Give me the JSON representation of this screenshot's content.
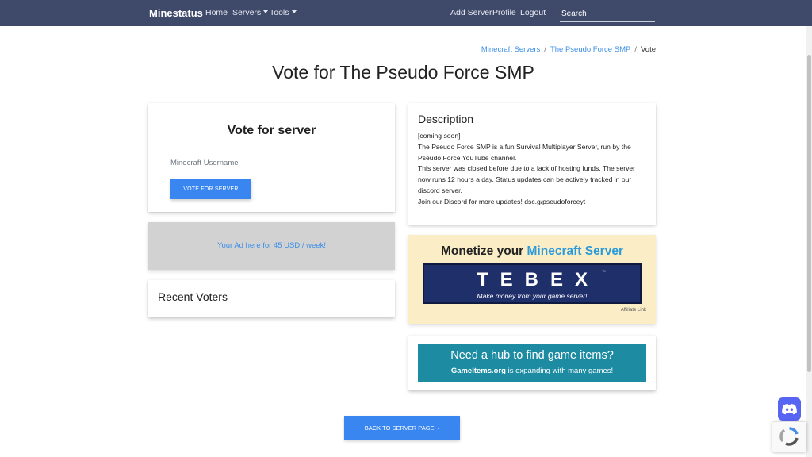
{
  "navbar": {
    "brand": "Minestatus",
    "links": {
      "home": "Home",
      "servers": "Servers",
      "tools": "Tools",
      "add_server": "Add Server",
      "profile": "Profile",
      "logout": "Logout"
    },
    "search_placeholder": "Search"
  },
  "breadcrumb": {
    "items": [
      "Minecraft Servers",
      "The Pseudo Force SMP",
      "Vote"
    ]
  },
  "page_title": "Vote for The Pseudo Force SMP",
  "vote_card": {
    "heading": "Vote for server",
    "username_placeholder": "Minecraft Username",
    "button_label": "VOTE FOR SERVER"
  },
  "ad": {
    "text": "Your Ad here for 45 USD / week!"
  },
  "recent_voters": {
    "heading": "Recent Voters"
  },
  "description": {
    "heading": "Description",
    "lines": [
      "[coming soon]",
      "The Pseudo Force SMP is a fun Survival Multiplayer Server, run by the Pseudo Force YouTube channel.",
      "This server was closed before due to a lack of hosting funds. The server now runs 12 hours a day. Status updates can be actively tracked in our discord server.",
      "Join our Discord for more updates! dsc.g/pseudoforceyt"
    ]
  },
  "monetize": {
    "title_prefix": "Monetize your",
    "title_highlight": "Minecraft Server",
    "logo": "TEBEX",
    "tm": "™",
    "tagline": "Make money from your game server!",
    "affiliate": "Affiliate Link"
  },
  "hub": {
    "title": "Need a hub to find game items?",
    "site": "GameItems.org",
    "sub_rest": " is expanding with many games!"
  },
  "back_button": {
    "label": "BACK TO SERVER PAGE",
    "icon": "‹"
  },
  "colors": {
    "navbar": "#3f4a6b",
    "primary_button": "#3a86f0",
    "link": "#3b8ee6",
    "monetize_bg": "#fbeec7",
    "tebex_bg": "#1f2f6a",
    "hub_bg": "#1d8ca3",
    "ad_bg": "#d2d2d2",
    "discord": "#5865f2"
  },
  "icons": {
    "discord": "discord-icon",
    "recaptcha": "recaptcha-icon",
    "caret": "chevron-down-icon"
  }
}
